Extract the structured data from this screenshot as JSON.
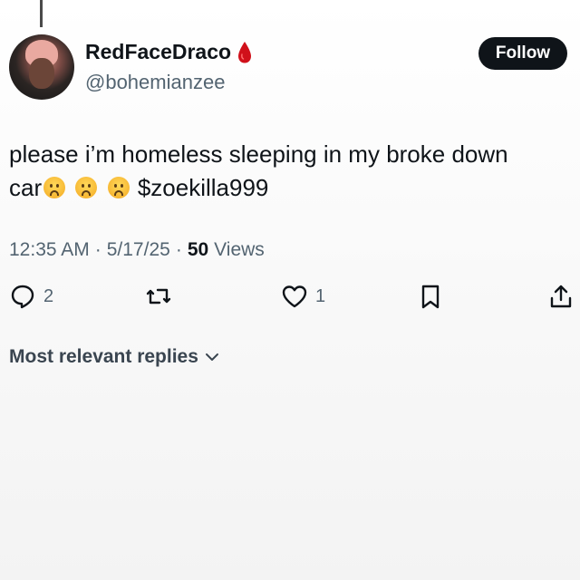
{
  "user": {
    "display_name": "RedFaceDraco",
    "handle": "@bohemianzee",
    "badge_icon": "blood-drop-icon"
  },
  "follow_label": "Follow",
  "tweet": {
    "line1": "please i’m homeless sleeping in my broke down",
    "line2_prefix": "car",
    "emoji": [
      "frowning-face-emoji",
      "frowning-face-emoji",
      "frowning-face-emoji"
    ],
    "line2_suffix": "$zoekilla999"
  },
  "meta": {
    "time": "12:35 AM",
    "separator1": "·",
    "date": "5/17/25",
    "separator2": "·",
    "views_count": "50",
    "views_label": "Views"
  },
  "actions": {
    "reply_count": "2",
    "like_count": "1"
  },
  "replies_sort_label": "Most relevant replies",
  "colors": {
    "text": "#0f1419",
    "secondary": "#536471",
    "button_bg": "#0f1419",
    "badge": "#d0101a"
  }
}
